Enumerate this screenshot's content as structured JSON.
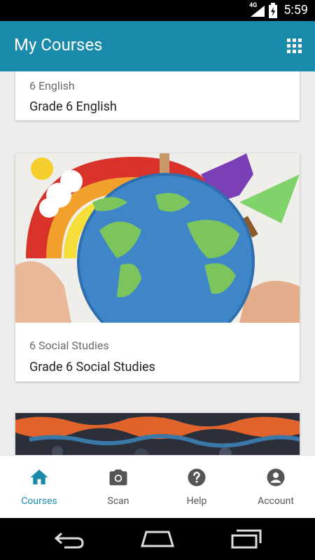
{
  "status_bar": {
    "network": "4G",
    "time": "5:59"
  },
  "app_bar": {
    "title": "My Courses",
    "grid_icon": "grid-icon"
  },
  "courses": [
    {
      "code": "6 English",
      "name": "Grade 6 English"
    },
    {
      "code": "6 Social Studies",
      "name": "Grade 6 Social Studies"
    }
  ],
  "bottom_nav": [
    {
      "label": "Courses",
      "icon": "home-icon",
      "active": true
    },
    {
      "label": "Scan",
      "icon": "camera-icon",
      "active": false
    },
    {
      "label": "Help",
      "icon": "help-icon",
      "active": false
    },
    {
      "label": "Account",
      "icon": "account-icon",
      "active": false
    }
  ],
  "colors": {
    "accent": "#1a8aab",
    "inactive": "#555555"
  }
}
